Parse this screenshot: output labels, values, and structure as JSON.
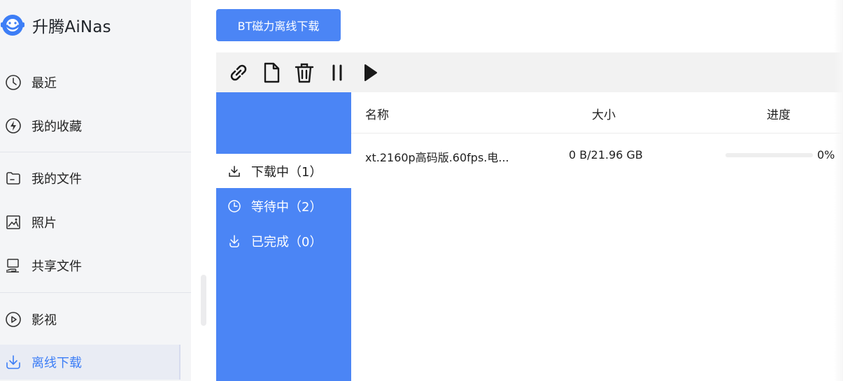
{
  "brand": {
    "name": "升腾AiNas"
  },
  "nav": {
    "items": [
      {
        "label": "最近",
        "icon": "clock-icon"
      },
      {
        "label": "我的收藏",
        "icon": "bolt-icon"
      },
      {
        "label": "我的文件",
        "icon": "folder-icon"
      },
      {
        "label": "照片",
        "icon": "image-icon"
      },
      {
        "label": "共享文件",
        "icon": "share-hand-icon"
      },
      {
        "label": "影视",
        "icon": "play-circle-icon"
      },
      {
        "label": "离线下载",
        "icon": "download-icon"
      }
    ],
    "active": "离线下载"
  },
  "toolbar": {
    "bt_button_label": "BT磁力离线下载",
    "tools": [
      "link-icon",
      "file-icon",
      "trash-icon",
      "pause-icon",
      "play-icon"
    ]
  },
  "tabs": {
    "items": [
      {
        "label": "下载中（1）",
        "icon": "download-tray-icon"
      },
      {
        "label": "等待中（2）",
        "icon": "clock-icon"
      },
      {
        "label": "已完成（0）",
        "icon": "download-arrow-icon"
      }
    ],
    "active": "下载中（1）"
  },
  "table": {
    "headers": {
      "name": "名称",
      "size": "大小",
      "progress": "进度"
    },
    "rows": [
      {
        "name": "xt.2160p高码版.60fps.电...",
        "size": "0 B/21.96 GB",
        "progress_text": "0%",
        "progress": 0
      }
    ]
  },
  "colors": {
    "accent": "#4b85f5",
    "sidebar_bg": "#f4f5f7",
    "toolbar_bg": "#f2f2f2"
  }
}
